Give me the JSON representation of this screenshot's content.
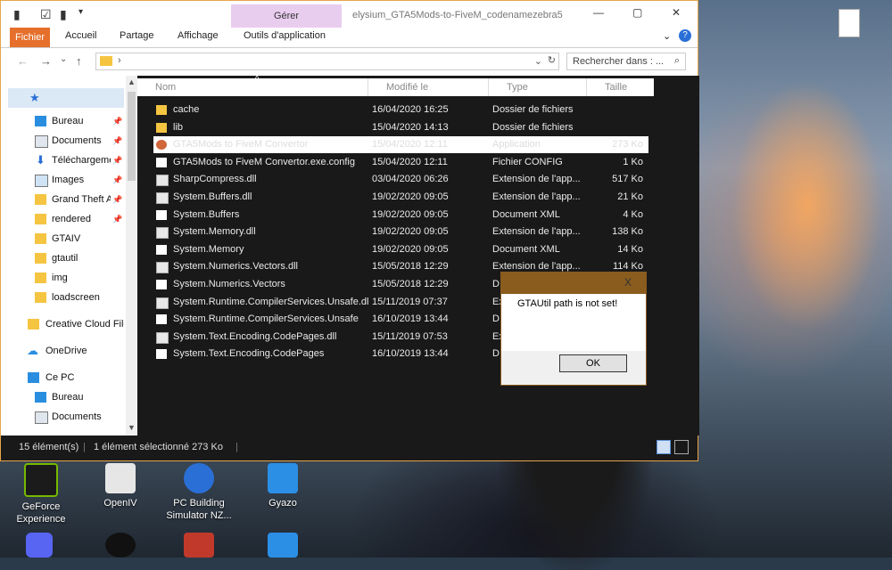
{
  "window": {
    "manage_tab": "Gérer",
    "title": "elysium_GTA5Mods-to-FiveM_codenamezebra5"
  },
  "ribbon": {
    "tabs": [
      {
        "label": "Fichier",
        "active": true
      },
      {
        "label": "Accueil"
      },
      {
        "label": "Partage"
      },
      {
        "label": "Affichage"
      },
      {
        "label": "Outils d'application"
      }
    ],
    "help": "?"
  },
  "addressbar": {
    "separator": "›",
    "search_placeholder": "Rechercher dans : ..."
  },
  "nav": {
    "items": [
      {
        "label": "Bureau",
        "pinned": true,
        "icon": "desktop-icon"
      },
      {
        "label": "Documents",
        "pinned": true,
        "icon": "document-icon"
      },
      {
        "label": "Téléchargements",
        "pinned": true,
        "icon": "download-icon"
      },
      {
        "label": "Images",
        "pinned": true,
        "icon": "image-icon"
      },
      {
        "label": "Grand Theft Auto V",
        "pinned": true,
        "icon": "folder-icon"
      },
      {
        "label": "rendered",
        "pinned": true,
        "icon": "folder-icon"
      },
      {
        "label": "GTAIV",
        "icon": "folder-icon"
      },
      {
        "label": "gtautil",
        "icon": "folder-icon"
      },
      {
        "label": "img",
        "icon": "folder-icon"
      },
      {
        "label": "loadscreen",
        "icon": "folder-icon"
      }
    ],
    "creative_cloud": "Creative Cloud Files",
    "onedrive": "OneDrive",
    "this_pc": "Ce PC",
    "pc_items": [
      "Bureau",
      "Documents"
    ]
  },
  "columns": {
    "name": "Nom",
    "modified": "Modifié le",
    "type": "Type",
    "size": "Taille"
  },
  "files": [
    {
      "name": "cache",
      "date": "16/04/2020 16:25",
      "type": "Dossier de fichiers",
      "size": "",
      "kind": "folder"
    },
    {
      "name": "lib",
      "date": "15/04/2020 14:13",
      "type": "Dossier de fichiers",
      "size": "",
      "kind": "folder"
    },
    {
      "name": "GTA5Mods to FiveM Convertor",
      "date": "15/04/2020 12:11",
      "type": "Application",
      "size": "273 Ko",
      "kind": "exe",
      "selected": true
    },
    {
      "name": "GTA5Mods to FiveM Convertor.exe.config",
      "date": "15/04/2020 12:11",
      "type": "Fichier CONFIG",
      "size": "1 Ko",
      "kind": "file"
    },
    {
      "name": "SharpCompress.dll",
      "date": "03/04/2020 06:26",
      "type": "Extension de l'app...",
      "size": "517 Ko",
      "kind": "dll"
    },
    {
      "name": "System.Buffers.dll",
      "date": "19/02/2020 09:05",
      "type": "Extension de l'app...",
      "size": "21 Ko",
      "kind": "dll"
    },
    {
      "name": "System.Buffers",
      "date": "19/02/2020 09:05",
      "type": "Document XML",
      "size": "4 Ko",
      "kind": "file"
    },
    {
      "name": "System.Memory.dll",
      "date": "19/02/2020 09:05",
      "type": "Extension de l'app...",
      "size": "138 Ko",
      "kind": "dll"
    },
    {
      "name": "System.Memory",
      "date": "19/02/2020 09:05",
      "type": "Document XML",
      "size": "14 Ko",
      "kind": "file"
    },
    {
      "name": "System.Numerics.Vectors.dll",
      "date": "15/05/2018 12:29",
      "type": "Extension de l'app...",
      "size": "114 Ko",
      "kind": "dll"
    },
    {
      "name": "System.Numerics.Vectors",
      "date": "15/05/2018 12:29",
      "type": "D",
      "size": "",
      "kind": "file"
    },
    {
      "name": "System.Runtime.CompilerServices.Unsafe.dll",
      "date": "15/11/2019 07:37",
      "type": "Ex",
      "size": "",
      "kind": "dll"
    },
    {
      "name": "System.Runtime.CompilerServices.Unsafe",
      "date": "16/10/2019 13:44",
      "type": "D",
      "size": "",
      "kind": "file"
    },
    {
      "name": "System.Text.Encoding.CodePages.dll",
      "date": "15/11/2019 07:53",
      "type": "Ex",
      "size": "",
      "kind": "dll"
    },
    {
      "name": "System.Text.Encoding.CodePages",
      "date": "16/10/2019 13:44",
      "type": "D",
      "size": "",
      "kind": "file"
    }
  ],
  "status": {
    "count": "15 élément(s)",
    "selected": "1 élément sélectionné  273 Ko"
  },
  "dialog": {
    "close": "X",
    "message": "GTAUtil path is not set!",
    "ok": "OK"
  },
  "desktop": {
    "icons": [
      {
        "label": "GeForce Experience",
        "color": "#76b900"
      },
      {
        "label": "OpenIV",
        "color": "#e6e6e6"
      },
      {
        "label": "PC Building Simulator NZ...",
        "color": "#2a6fd6"
      },
      {
        "label": "Gyazo",
        "color": "#2b8fe6"
      }
    ]
  }
}
